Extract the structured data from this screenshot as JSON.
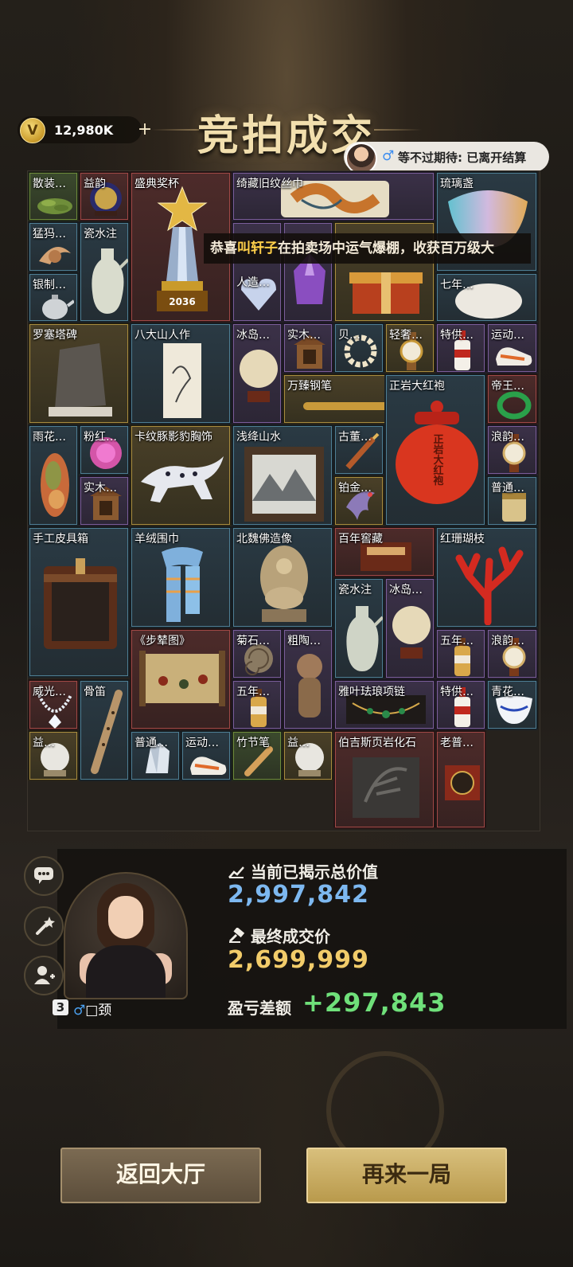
{
  "header": {
    "title": "竞拍成交",
    "coins": "12,980K",
    "coin_letter": "V",
    "plus": "+",
    "waiting_symbol": "♂",
    "waiting_status": "等不过期待: 已离开结算"
  },
  "notice": {
    "prefix": "恭喜",
    "name": "叫轩子",
    "suffix": "在拍卖场中运气爆棚，收获百万级大"
  },
  "items": [
    {
      "label": "散装…"
    },
    {
      "label": "益韵"
    },
    {
      "label": "盛典奖杯",
      "year": "2036"
    },
    {
      "label": "绮藏旧纹丝巾"
    },
    {
      "label": "琉璃盏"
    },
    {
      "label": "猛犸…"
    },
    {
      "label": "瓷水注"
    },
    {
      "label": "银制…"
    },
    {
      "label": "人造…"
    },
    {
      "label": "七年…"
    },
    {
      "label": "罗塞塔碑"
    },
    {
      "label": "八大山人作"
    },
    {
      "label": "冰岛…"
    },
    {
      "label": "实木…"
    },
    {
      "label": "贝…"
    },
    {
      "label": "轻奢…"
    },
    {
      "label": "特供…"
    },
    {
      "label": "运动…"
    },
    {
      "label": "万臻钢笔"
    },
    {
      "label": "正岩大红袍",
      "jar_text": "正岩大红袍"
    },
    {
      "label": "帝王…"
    },
    {
      "label": "雨花…"
    },
    {
      "label": "粉红…"
    },
    {
      "label": "卡纹豚影豹胸饰"
    },
    {
      "label": "浅绛山水"
    },
    {
      "label": "古董…"
    },
    {
      "label": "浪韵…"
    },
    {
      "label": "实木…"
    },
    {
      "label": "铂金…"
    },
    {
      "label": "普通…"
    },
    {
      "label": "手工皮具箱"
    },
    {
      "label": "羊绒围巾"
    },
    {
      "label": "北魏佛造像"
    },
    {
      "label": "百年窖藏"
    },
    {
      "label": "红珊瑚枝"
    },
    {
      "label": "瓷水注"
    },
    {
      "label": "冰岛…"
    },
    {
      "label": "《步辇图》"
    },
    {
      "label": "菊石…"
    },
    {
      "label": "粗陶…"
    },
    {
      "label": "五年…"
    },
    {
      "label": "浪韵…"
    },
    {
      "label": "威光…"
    },
    {
      "label": "骨笛"
    },
    {
      "label": "五年…"
    },
    {
      "label": "雅叶珐琅项链"
    },
    {
      "label": "特供…"
    },
    {
      "label": "青花…"
    },
    {
      "label": "益…"
    },
    {
      "label": "普通…"
    },
    {
      "label": "运动…"
    },
    {
      "label": "竹节笔"
    },
    {
      "label": "益…"
    },
    {
      "label": "伯吉斯页岩化石"
    },
    {
      "label": "老普…"
    }
  ],
  "result": {
    "revealed_label": "当前已揭示总价值",
    "revealed_value": "2,997,842",
    "final_label": "最终成交价",
    "final_value": "2,699,999",
    "diff_label": "盈亏差额",
    "diff_value": "+297,843"
  },
  "player": {
    "level": "3",
    "gender": "♂",
    "name": "□颈"
  },
  "buttons": {
    "back": "返回大厅",
    "again": "再来一局"
  },
  "colors": {
    "revealed": "#7db8f0",
    "final": "#f2cc6a",
    "diff": "#6fe07a"
  }
}
